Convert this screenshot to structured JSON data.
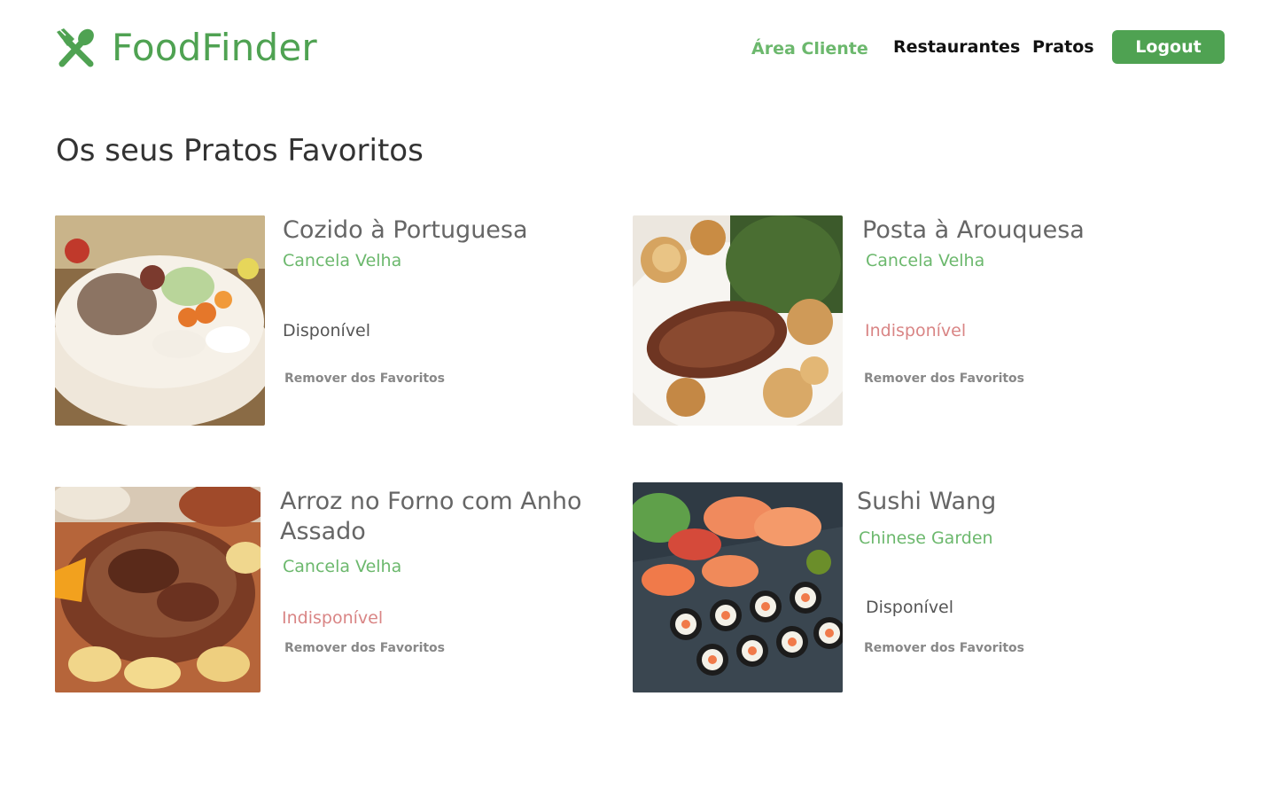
{
  "header": {
    "brand": "FoodFinder",
    "nav": {
      "client_area": "Área Cliente",
      "restaurants": "Restaurantes",
      "dishes": "Pratos"
    },
    "logout_label": "Logout"
  },
  "main": {
    "title": "Os seus Pratos Favoritos",
    "remove_label": "Remover dos Favoritos",
    "favorites": [
      {
        "dish": "Cozido à Portuguesa",
        "restaurant": "Cancela Velha",
        "status": "Disponível",
        "available": true
      },
      {
        "dish": "Posta à Arouquesa",
        "restaurant": "Cancela Velha",
        "status": "Indisponível",
        "available": false
      },
      {
        "dish": "Arroz no Forno com Anho Assado",
        "restaurant": "Cancela Velha",
        "status": "Indisponível",
        "available": false
      },
      {
        "dish": "Sushi Wang",
        "restaurant": "Chinese Garden",
        "status": "Disponível",
        "available": true
      }
    ]
  },
  "colors": {
    "brand_green": "#4fa252",
    "link_green": "#6cb86d",
    "unavailable_red": "#d98585",
    "text_gray": "#666666"
  },
  "icons": {
    "logo": "fork-spoon-cross-icon"
  }
}
